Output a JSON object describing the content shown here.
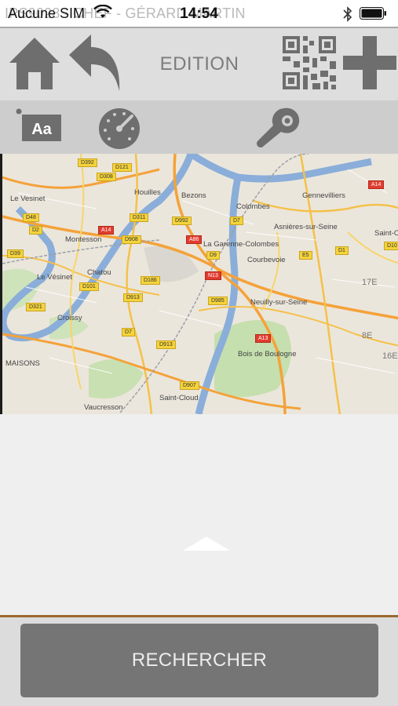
{
  "status_bar": {
    "carrier": "Aucune SIM",
    "background_text": "IPS9028 - CHEF - GÉRARD MARTIN",
    "time": "14:54",
    "icons": [
      "wifi-icon",
      "bluetooth-icon",
      "battery-icon"
    ]
  },
  "top_bar": {
    "title": "EDITION",
    "buttons": [
      "home-icon",
      "back-arrow-icon",
      "qr-code-icon",
      "plus-icon"
    ]
  },
  "tool_bar": {
    "buttons": [
      "text-style-icon",
      "gauge-icon",
      "wrench-icon"
    ],
    "text_style_glyph": "Aa"
  },
  "map": {
    "places": [
      {
        "name": "Houilles"
      },
      {
        "name": "Bezons"
      },
      {
        "name": "Colombes"
      },
      {
        "name": "Gennevilliers"
      },
      {
        "name": "Le Vesinet"
      },
      {
        "name": "Montesson"
      },
      {
        "name": "Asnières-sur-Seine"
      },
      {
        "name": "La Garenne-Colombes"
      },
      {
        "name": "Courbevoie"
      },
      {
        "name": "Saint-O"
      },
      {
        "name": "Chatou"
      },
      {
        "name": "Le Vésinet"
      },
      {
        "name": "Neuilly-sur-Seine"
      },
      {
        "name": "Croissy"
      },
      {
        "name": "Bois de Boulogne"
      },
      {
        "name": "Saint-Cloud"
      },
      {
        "name": "Vaucresson"
      },
      {
        "name": "17E"
      },
      {
        "name": "8E"
      },
      {
        "name": "16E"
      },
      {
        "name": "MAISONS"
      }
    ],
    "shields": [
      "D392",
      "D121",
      "D308",
      "D311",
      "D48",
      "D2",
      "D992",
      "D7",
      "A14",
      "A86",
      "D908",
      "D186",
      "D913",
      "D39",
      "D9",
      "D101",
      "D321",
      "D985",
      "N13",
      "A13",
      "D7",
      "D913",
      "D907",
      "D1",
      "D10",
      "E5",
      "A14"
    ]
  },
  "bottom": {
    "search_label": "RECHERCHER"
  },
  "colors": {
    "accent_line": "#9a6a2e",
    "button_gray": "#757575",
    "icon_gray": "#6e6e6e"
  }
}
